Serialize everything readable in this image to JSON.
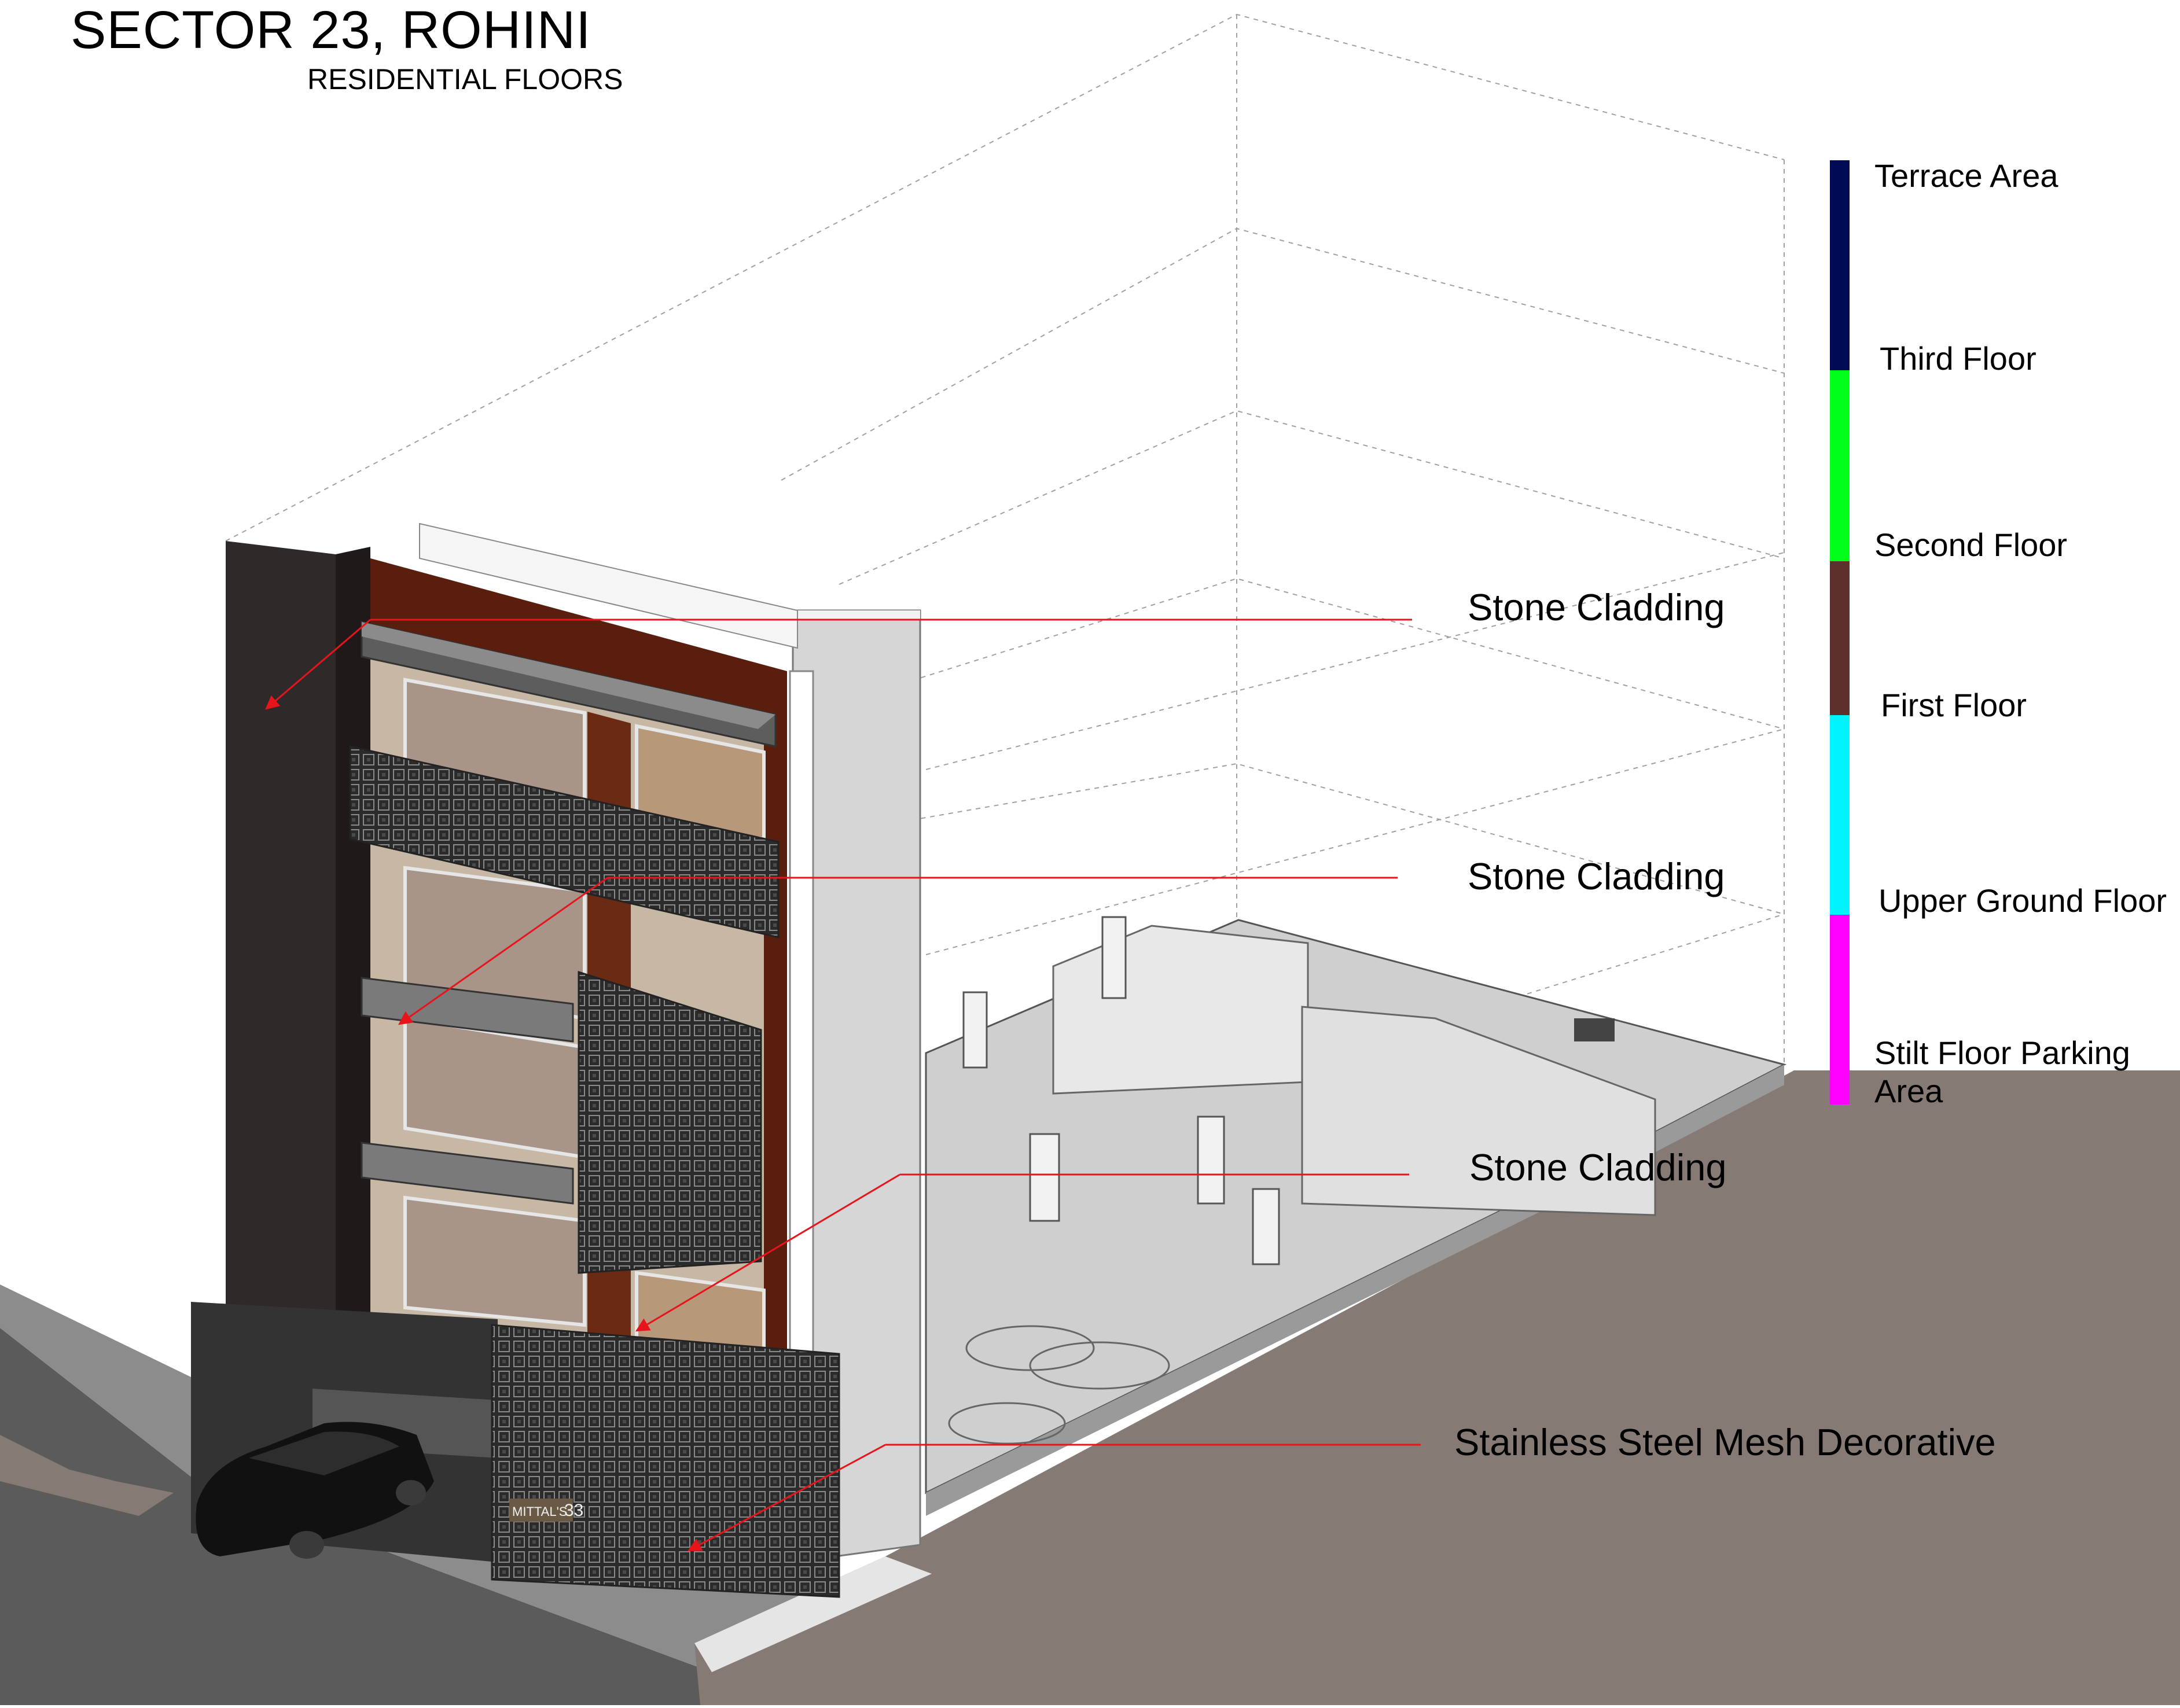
{
  "header": {
    "title": "SECTOR 23, ROHINI",
    "subtitle": "RESIDENTIAL FLOORS"
  },
  "callouts": [
    {
      "label": "Stone Cladding"
    },
    {
      "label": "Stone Cladding"
    },
    {
      "label": "Stone Cladding"
    },
    {
      "label": "Stainless Steel Mesh Decorative"
    }
  ],
  "legend": [
    {
      "label": "Terrace Area",
      "color": "#000a52"
    },
    {
      "label": "Third Floor",
      "color": "#00ff19"
    },
    {
      "label": "Second Floor",
      "color": "#5f2f2e"
    },
    {
      "label": "First Floor",
      "color": "#00f4ff"
    },
    {
      "label": "Upper Ground Floor",
      "color": "#ff00ff"
    },
    {
      "label": "Stilt Floor Parking Area",
      "color": "#ff00ff"
    }
  ],
  "building": {
    "signage_text": "MITTAL'S",
    "house_number": "33"
  },
  "colors": {
    "callout_line": "#e8141c",
    "cladding_dark": "#2f2929",
    "cladding_brown": "#5a1e0f",
    "glass": "#a89488",
    "mesh": "#262626",
    "road": "#5b5b5b",
    "pavement": "#857a74"
  }
}
